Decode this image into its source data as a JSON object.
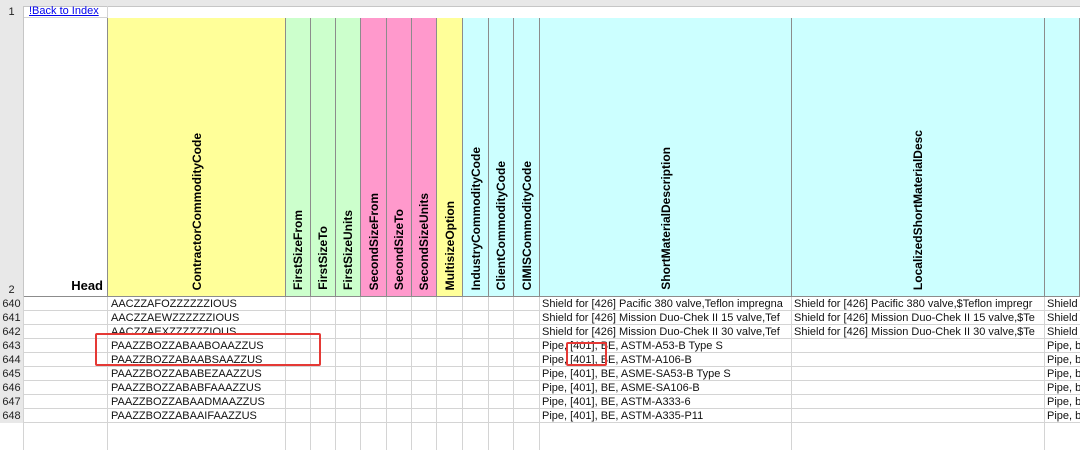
{
  "link_cell": "!Back to Index",
  "head_label": "Head",
  "row_numbers": [
    "1",
    "2",
    "640",
    "641",
    "642",
    "643",
    "644",
    "645",
    "646",
    "647",
    "648"
  ],
  "columns": [
    {
      "name": "ContractorCommodityCode",
      "color": "#ffff99"
    },
    {
      "name": "FirstSizeFrom",
      "color": "#ccffcc"
    },
    {
      "name": "FirstSizeTo",
      "color": "#ccffcc"
    },
    {
      "name": "FirstSizeUnits",
      "color": "#ccffcc"
    },
    {
      "name": "SecondSizeFrom",
      "color": "#ff99cc"
    },
    {
      "name": "SecondSizeTo",
      "color": "#ff99cc"
    },
    {
      "name": "SecondSizeUnits",
      "color": "#ff99cc"
    },
    {
      "name": "MultisizeOption",
      "color": "#ffff99"
    },
    {
      "name": "IndustryCommodityCode",
      "color": "#ccffff"
    },
    {
      "name": "ClientCommodityCode",
      "color": "#ccffff"
    },
    {
      "name": "CIMISCommodityCode",
      "color": "#ccffff"
    },
    {
      "name": "ShortMaterialDescription",
      "color": "#ccffff"
    },
    {
      "name": "LocalizedShortMaterialDesc",
      "color": "#ccffff"
    },
    {
      "name": "",
      "color": "#ccffff"
    }
  ],
  "rows": [
    {
      "code": "AACZZAFOZZZZZZIOUS",
      "desc": "Shield for [426] Pacific 380 valve,Teflon impregna",
      "local": "Shield for [426] Pacific 380 valve,$Teflon impregr",
      "extra": "Shield"
    },
    {
      "code": "AACZZAEWZZZZZZIOUS",
      "desc": "Shield for [426] Mission Duo-Chek II 15 valve,Tef",
      "local": "Shield for [426] Mission Duo-Chek II 15 valve,$Te",
      "extra": "Shield"
    },
    {
      "code": "AACZZAEXZZZZZZIOUS",
      "desc": "Shield for [426] Mission Duo-Chek II 30 valve,Tef",
      "local": "Shield for [426] Mission Duo-Chek II 30 valve,$Te",
      "extra": "Shield"
    },
    {
      "code": "PAAZZBOZZABAABOAAZZUS",
      "desc": "Pipe, [401], BE, ASTM-A53-B Type S",
      "local": "",
      "extra": "Pipe, b"
    },
    {
      "code": "PAAZZBOZZABAABSAAZZUS",
      "desc": "Pipe, [401], BE, ASTM-A106-B",
      "local": "",
      "extra": "Pipe, b"
    },
    {
      "code": "PAAZZBOZZABABEZAAZZUS",
      "desc": "Pipe, [401], BE, ASME-SA53-B Type S",
      "local": "",
      "extra": "Pipe, b"
    },
    {
      "code": "PAAZZBOZZABABFAAAZZUS",
      "desc": "Pipe, [401], BE, ASME-SA106-B",
      "local": "",
      "extra": "Pipe, b"
    },
    {
      "code": "PAAZZBOZZABAADMAAZZUS",
      "desc": "Pipe, [401], BE, ASTM-A333-6",
      "local": "",
      "extra": "Pipe, b"
    },
    {
      "code": "PAAZZBOZZABAAIFAAZZUS",
      "desc": "Pipe, [401], BE, ASTM-A335-P11",
      "local": "",
      "extra": "Pipe, b"
    }
  ]
}
